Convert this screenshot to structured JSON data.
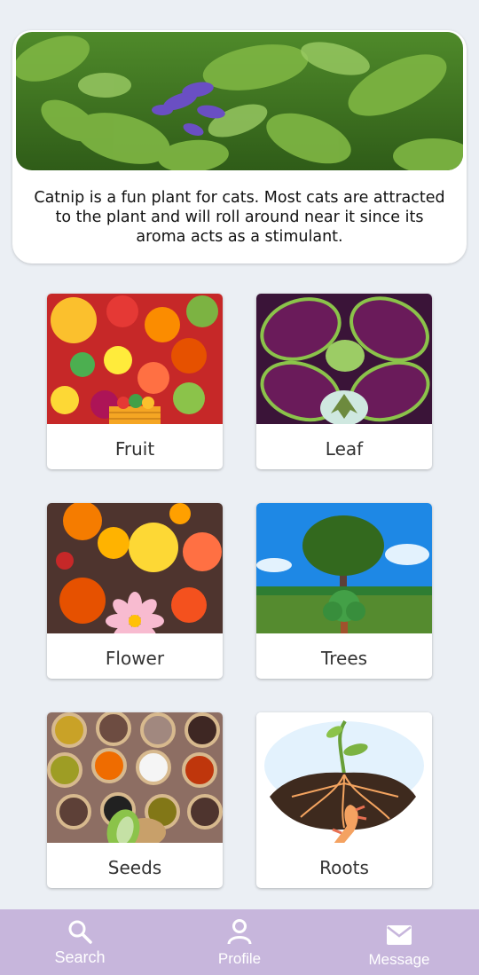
{
  "hero": {
    "description": "Catnip is a fun plant for cats. Most cats are attracted to the plant and will roll around near it since its aroma acts as a stimulant.",
    "image_subject": "catnip plant with purple flowers"
  },
  "categories": [
    {
      "label": "Fruit"
    },
    {
      "label": "Leaf"
    },
    {
      "label": "Flower"
    },
    {
      "label": "Trees"
    },
    {
      "label": "Seeds"
    },
    {
      "label": "Roots"
    }
  ],
  "bottom_nav": {
    "items": [
      {
        "label": "Search",
        "icon": "search-icon"
      },
      {
        "label": "Profile",
        "icon": "person-icon"
      },
      {
        "label": "Message",
        "icon": "mail-icon"
      }
    ]
  },
  "colors": {
    "background": "#ebeff4",
    "nav_background": "#c7b6dc",
    "nav_text": "#ffffff"
  }
}
